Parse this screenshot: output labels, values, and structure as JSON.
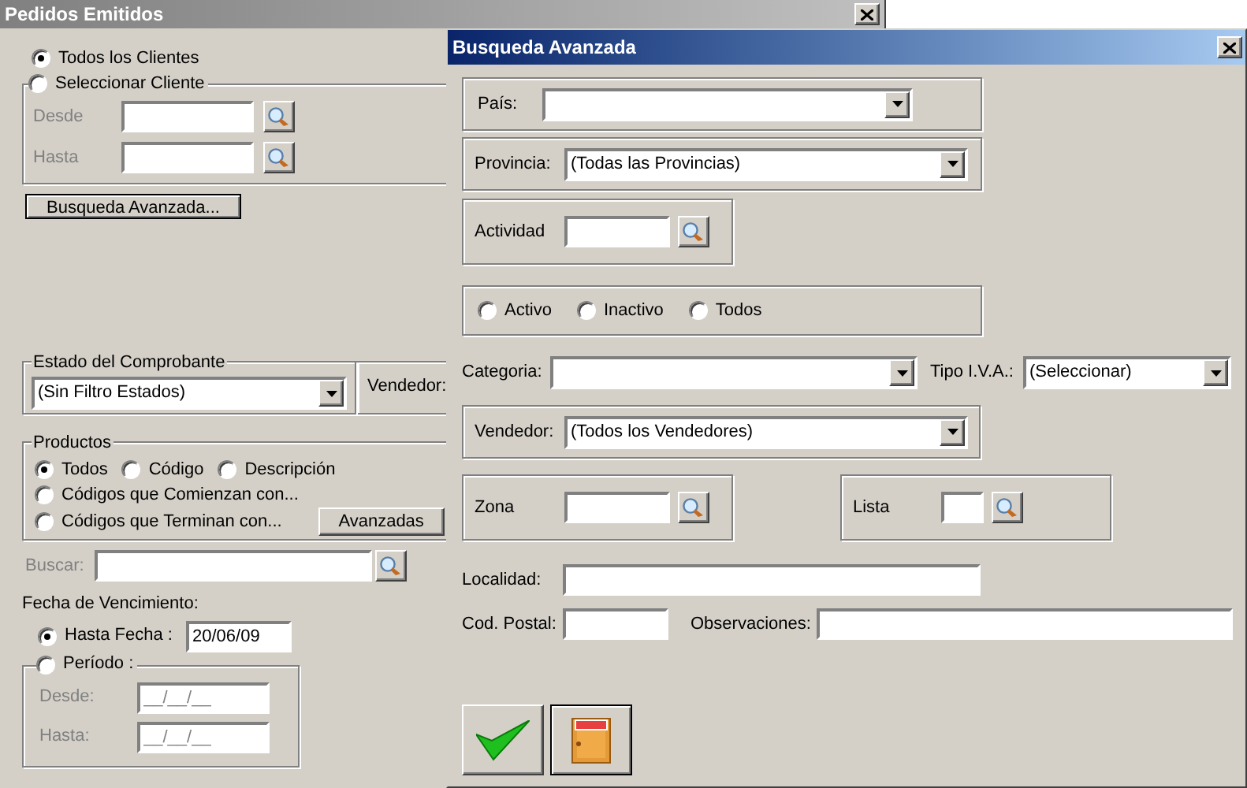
{
  "main_window": {
    "title": "Pedidos Emitidos",
    "client_options": [
      {
        "label": "Todos los Clientes",
        "selected": true
      },
      {
        "label": "Seleccionar Cliente",
        "selected": false
      }
    ],
    "client_range": [
      {
        "label": "Desde",
        "disabled": true
      },
      {
        "label": "Hasta",
        "disabled": true
      }
    ],
    "advanced_button": "Busqueda Avanzada...",
    "estado": {
      "legend": "Estado del Comprobante",
      "value": "(Sin Filtro Estados)"
    },
    "vendedor_label": "Vendedor:",
    "productos": {
      "legend": "Productos",
      "options": [
        {
          "label": "Todos",
          "selected": true
        },
        {
          "label": "Código",
          "selected": false
        },
        {
          "label": "Descripción",
          "selected": false
        },
        {
          "label": "Códigos que Comienzan con...",
          "selected": false
        },
        {
          "label": "Códigos que Terminan con...",
          "selected": false
        }
      ],
      "button": "Avanzadas"
    },
    "buscar": {
      "label": "Buscar:",
      "disabled": true
    },
    "fecha": {
      "heading": "Fecha de Vencimiento:",
      "options": [
        {
          "label": "Hasta Fecha :",
          "selected": true,
          "value": "20/06/09"
        },
        {
          "label": "Período :",
          "selected": false
        }
      ],
      "period_fields": [
        {
          "label": "Desde:",
          "placeholder": "__/__/__",
          "disabled": true
        },
        {
          "label": "Hasta:",
          "placeholder": "__/__/__",
          "disabled": true
        }
      ]
    }
  },
  "dialog": {
    "title": "Busqueda Avanzada",
    "pais": {
      "label": "País:"
    },
    "provincia": {
      "label": "Provincia:",
      "value": "(Todas las Provincias)"
    },
    "actividad": {
      "label": "Actividad"
    },
    "estado_options": [
      {
        "label": "Activo",
        "selected": false
      },
      {
        "label": "Inactivo",
        "selected": false
      },
      {
        "label": "Todos",
        "selected": false
      }
    ],
    "categoria": {
      "label": "Categoria:"
    },
    "tipo_iva": {
      "label": "Tipo I.V.A.:",
      "value": "(Seleccionar)"
    },
    "vendedor": {
      "label": "Vendedor:",
      "value": "(Todos los Vendedores)"
    },
    "zona": {
      "label": "Zona"
    },
    "lista": {
      "label": "Lista"
    },
    "localidad": {
      "label": "Localidad:"
    },
    "cod_postal": {
      "label": "Cod. Postal:"
    },
    "observaciones": {
      "label": "Observaciones:"
    }
  }
}
